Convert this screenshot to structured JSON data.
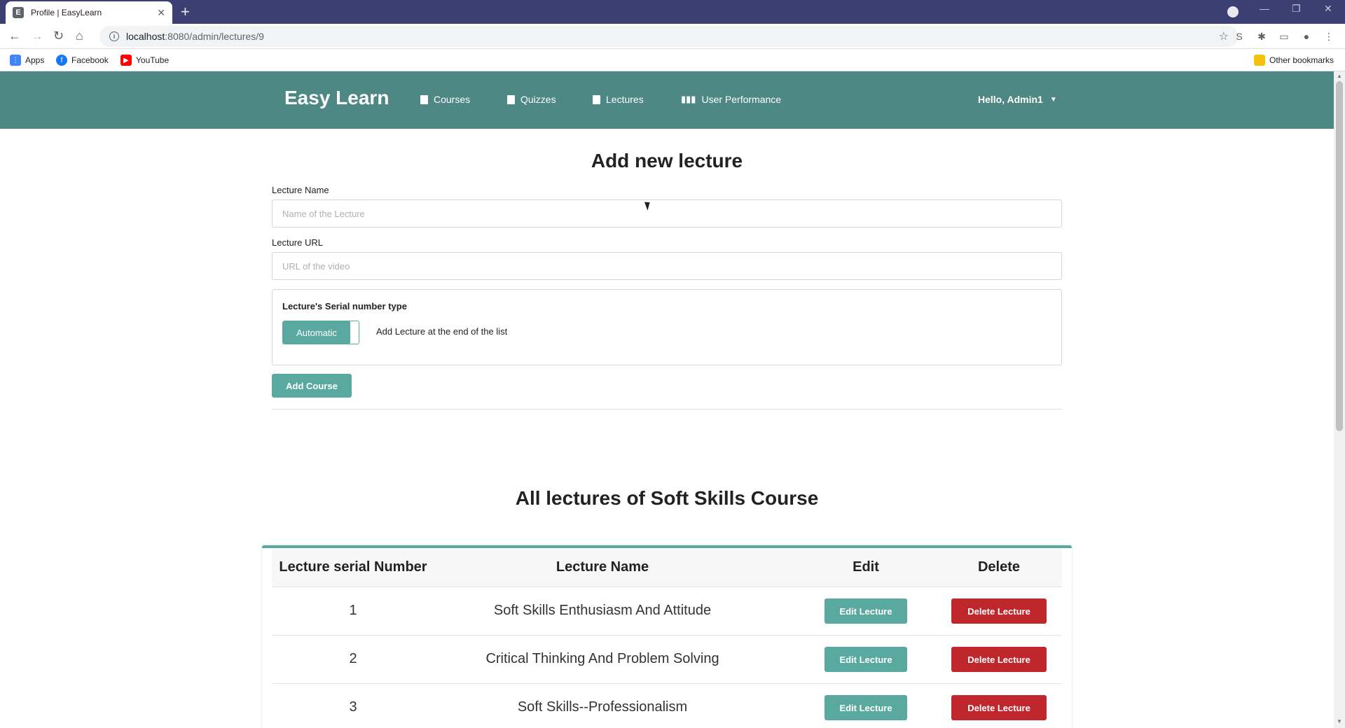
{
  "browser": {
    "tab_title": "Profile | EasyLearn",
    "tab_favicon": "easylearn-favicon",
    "url_host": "localhost",
    "url_path": ":8080/admin/lectures/9",
    "bookmarks": [
      {
        "label": "Apps",
        "icon": "apps-grid-icon",
        "color": "#4285f4"
      },
      {
        "label": "Facebook",
        "icon": "facebook-icon",
        "color": "#1877f2"
      },
      {
        "label": "YouTube",
        "icon": "youtube-icon",
        "color": "#ff0000"
      }
    ],
    "other_bookmarks": "Other bookmarks"
  },
  "navbar": {
    "brand": "Easy Learn",
    "links": [
      {
        "label": "Courses",
        "icon": "book-icon"
      },
      {
        "label": "Quizzes",
        "icon": "clipboard-icon"
      },
      {
        "label": "Lectures",
        "icon": "clipboard-icon"
      },
      {
        "label": "User Performance",
        "icon": "bar-chart-icon"
      }
    ],
    "user": "Hello, Admin1",
    "color": "#4e8885"
  },
  "form": {
    "title": "Add new lecture",
    "name_label": "Lecture Name",
    "name_placeholder": "Name of the Lecture",
    "url_label": "Lecture URL",
    "url_placeholder": "URL of the video",
    "serial_label": "Lecture's Serial number type",
    "serial_toggle": "Automatic",
    "serial_desc": "Add Lecture at the end of the list",
    "submit": "Add Course",
    "accent": "#5aa9a1"
  },
  "lectures": {
    "title": "All lectures of Soft Skills Course",
    "columns": [
      "Lecture serial Number",
      "Lecture Name",
      "Edit",
      "Delete"
    ],
    "rows": [
      {
        "serial": "1",
        "name": "Soft Skills Enthusiasm And Attitude",
        "edit": "Edit Lecture",
        "delete": "Delete Lecture"
      },
      {
        "serial": "2",
        "name": "Critical Thinking And Problem Solving",
        "edit": "Edit Lecture",
        "delete": "Delete Lecture"
      },
      {
        "serial": "3",
        "name": "Soft Skills--Professionalism",
        "edit": "Edit Lecture",
        "delete": "Delete Lecture"
      }
    ],
    "delete_color": "#c0272d"
  }
}
